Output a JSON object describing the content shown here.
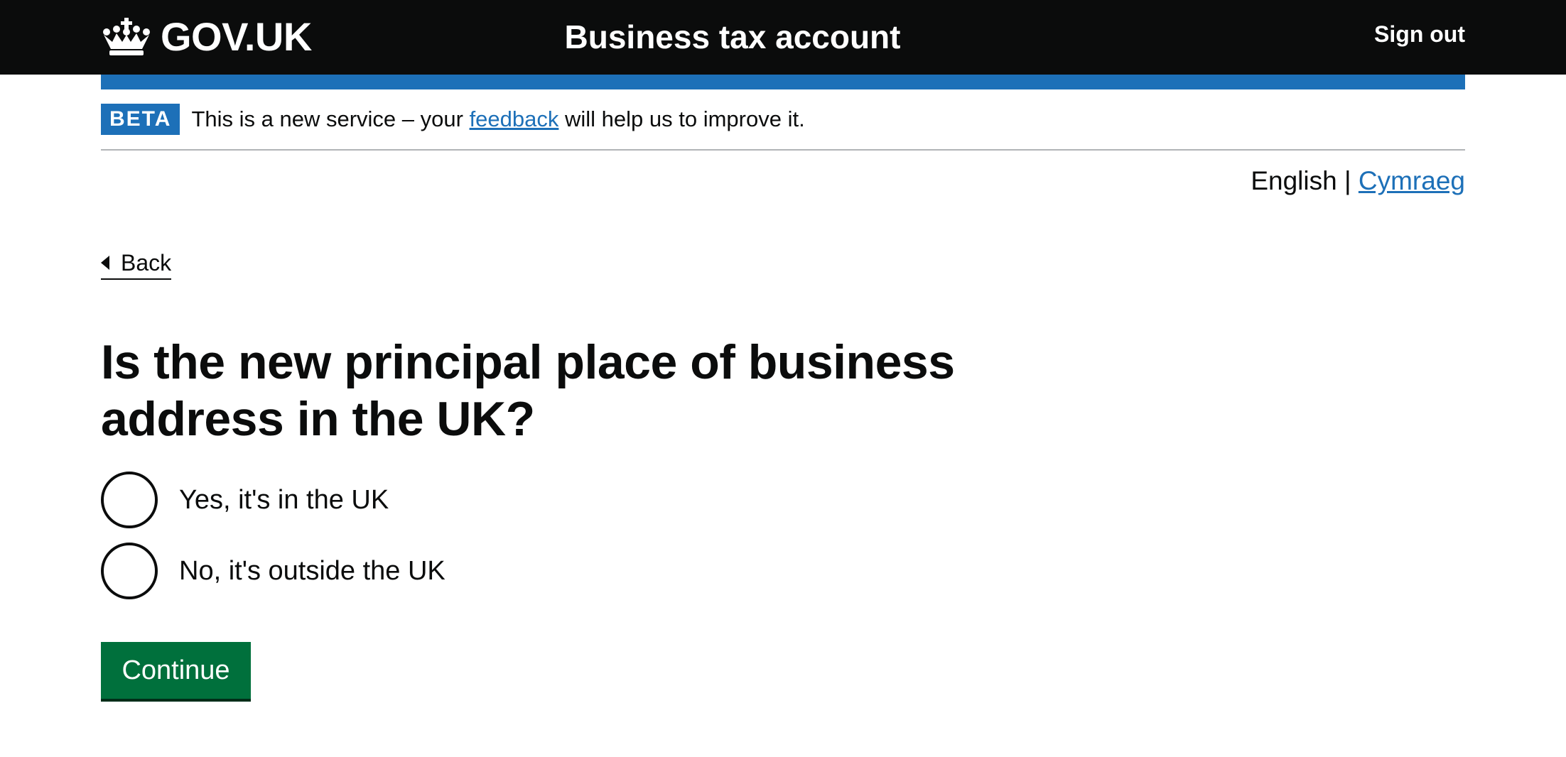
{
  "header": {
    "logo_text": "GOV.UK",
    "logo_icon": "crown-icon",
    "service_name": "Business tax account",
    "sign_out": "Sign out"
  },
  "phase_banner": {
    "tag": "BETA",
    "text_before": "This is a new service – your",
    "link": "feedback",
    "text_after": "will help us to improve it."
  },
  "language": {
    "current": "English",
    "separator": "|",
    "other": "Cymraeg"
  },
  "back_link": {
    "label": "Back",
    "icon": "back-arrow-icon"
  },
  "question": {
    "heading": "Is the new principal place of business address in the UK?",
    "options": [
      {
        "label": "Yes, it's in the UK",
        "selected": false
      },
      {
        "label": "No, it's outside the UK",
        "selected": false
      }
    ]
  },
  "actions": {
    "continue": "Continue"
  },
  "colors": {
    "header_bg": "#0b0c0c",
    "brand_blue": "#1d70b8",
    "button_green": "#00703c",
    "text": "#0b0c0c",
    "divider": "#b1b4b6"
  }
}
